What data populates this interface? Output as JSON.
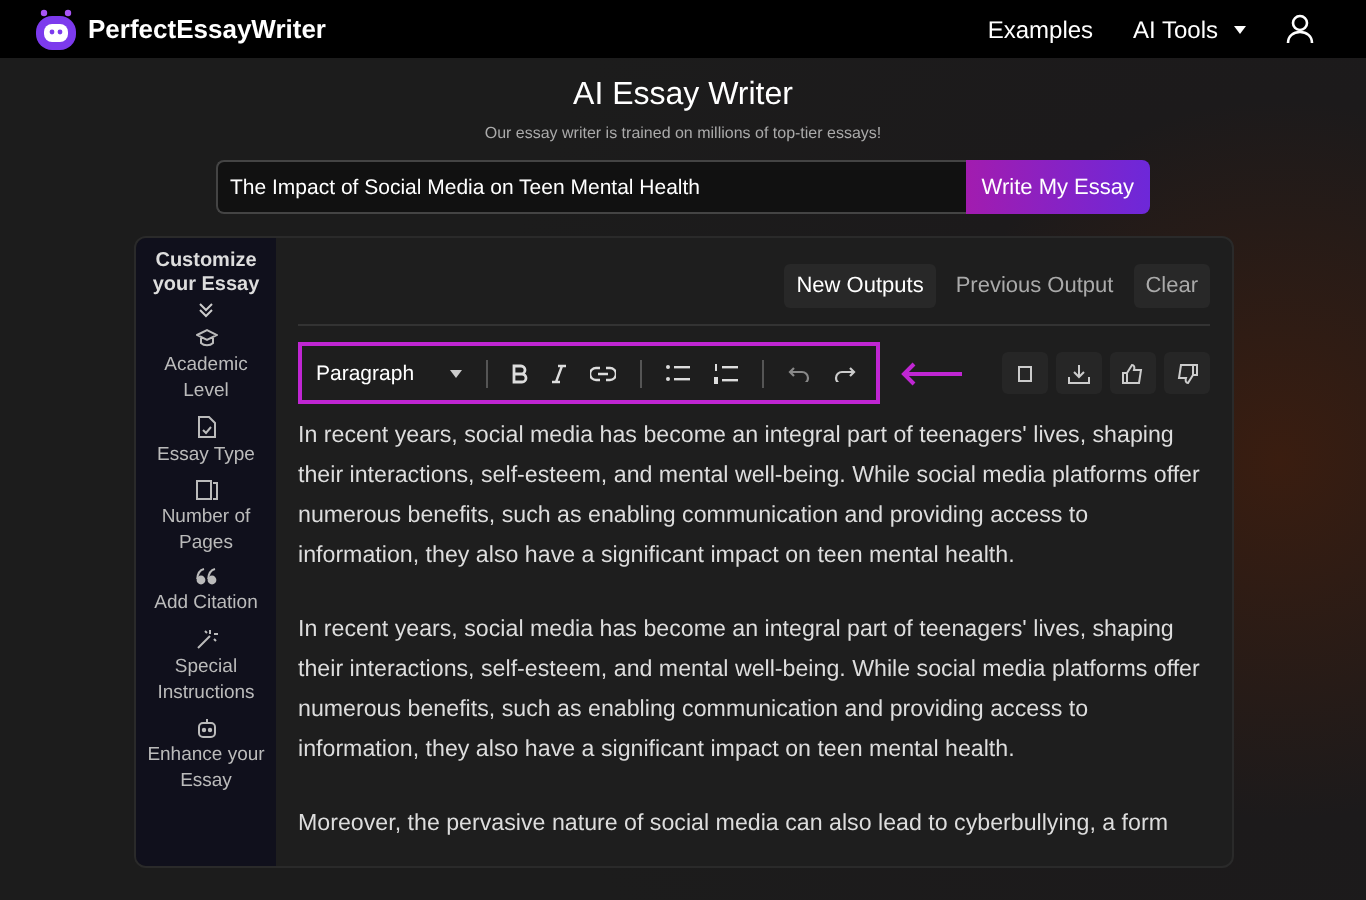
{
  "navbar": {
    "brand": "PerfectEssayWriter",
    "links": [
      {
        "label": "Examples",
        "dropdown": false
      },
      {
        "label": "AI Tools",
        "dropdown": true
      }
    ]
  },
  "hero": {
    "title": "AI Essay Writer",
    "subtitle": "Our essay writer is trained on millions of top-tier essays!",
    "topic": "The Impact of Social Media on Teen Mental Health",
    "button": "Write My Essay"
  },
  "sidebar": {
    "heading": "Customize your Essay",
    "items": [
      {
        "label": "Academic Level"
      },
      {
        "label": "Essay Type"
      },
      {
        "label": "Number of Pages"
      },
      {
        "label": "Add Citation"
      },
      {
        "label": "Special Instructions"
      },
      {
        "label": "Enhance your Essay"
      }
    ]
  },
  "tabs": [
    {
      "label": "New Outputs",
      "selected": true
    },
    {
      "label": "Previous Output",
      "selected": false
    }
  ],
  "clear_button": "Clear",
  "toolbar": {
    "format": "Paragraph",
    "highlighted": true
  },
  "paragraphs": [
    "In recent years, social media has become an integral part of teenagers' lives, shaping their interactions, self-esteem, and mental well-being. While social media platforms offer numerous benefits, such as enabling communication and providing access to information, they also have a significant impact on teen mental health.",
    "In recent years, social media has become an integral part of teenagers' lives, shaping their interactions, self-esteem, and mental well-being. While social media platforms offer numerous benefits, such as enabling communication and providing access to information, they also have a significant impact on teen mental health.",
    "Moreover, the pervasive nature of social media can also lead to cyberbullying, a form"
  ]
}
